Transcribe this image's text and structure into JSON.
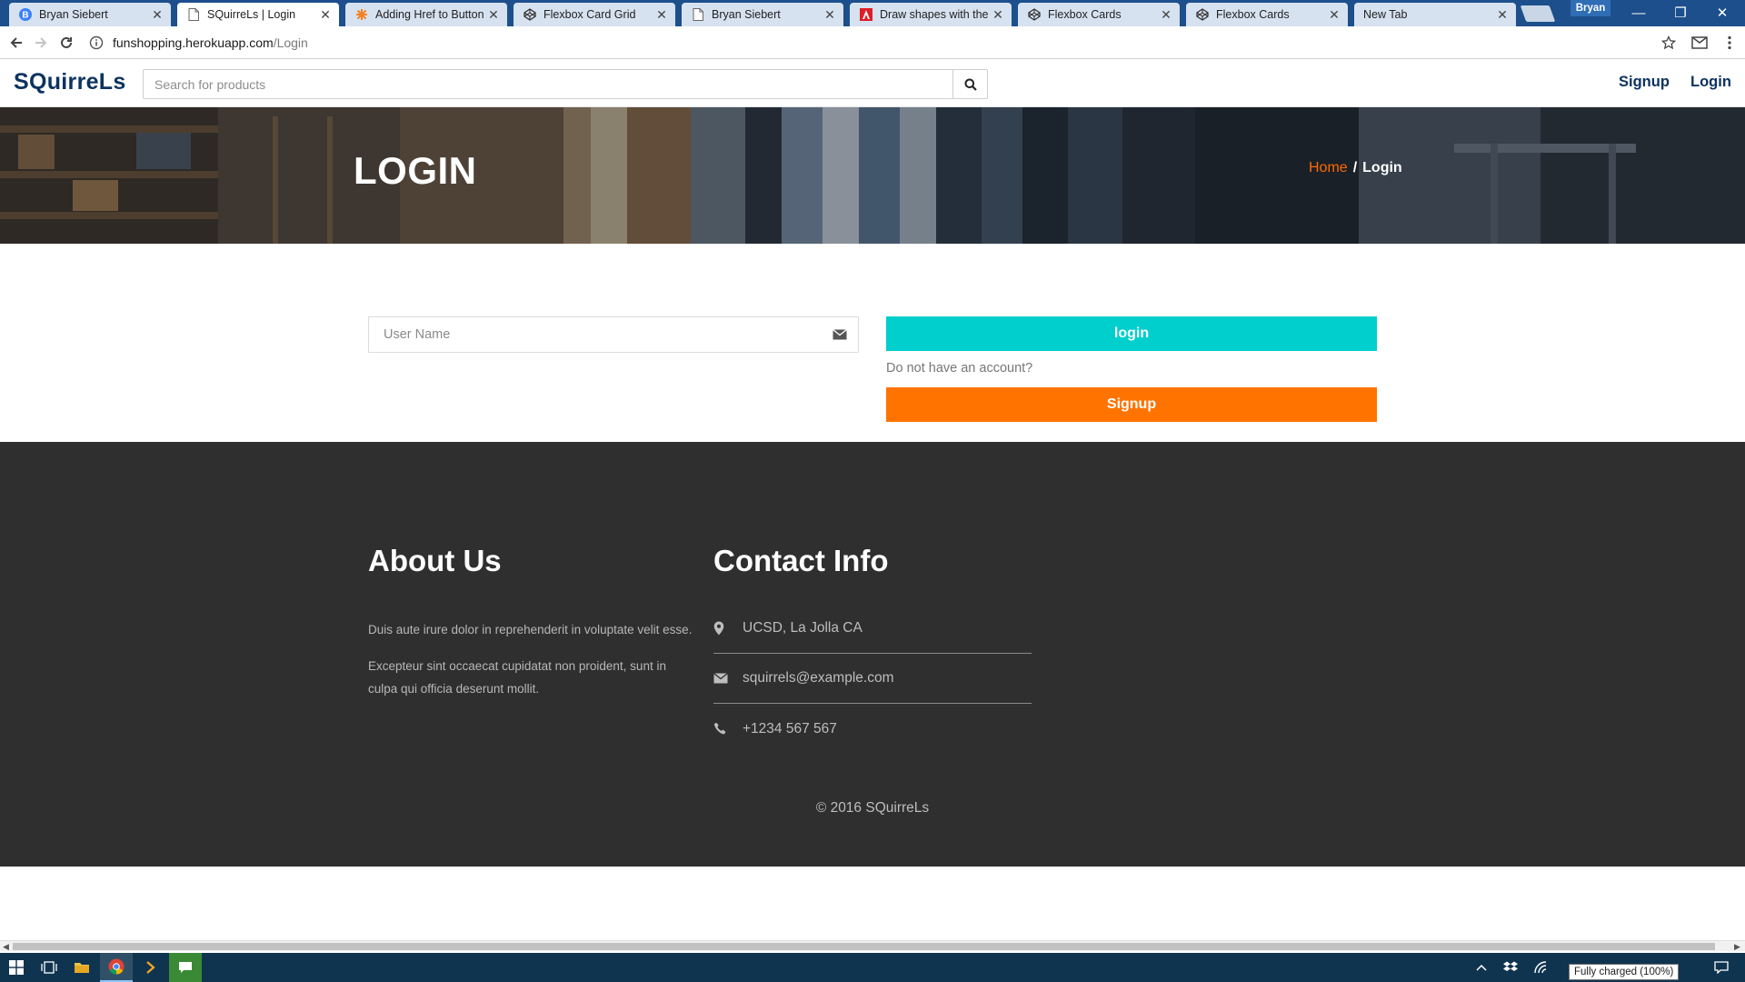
{
  "browser": {
    "tabs": [
      {
        "title": "Bryan Siebert",
        "icon": "b-circle-icon",
        "active": false
      },
      {
        "title": "SQuirreLs | Login",
        "icon": "page-icon",
        "active": true
      },
      {
        "title": "Adding Href to Button",
        "icon": "stackoverflow-icon",
        "active": false
      },
      {
        "title": "Flexbox Card Grid",
        "icon": "codepen-icon",
        "active": false
      },
      {
        "title": "Bryan Siebert",
        "icon": "page-icon",
        "active": false
      },
      {
        "title": "Draw shapes with the s",
        "icon": "adobe-icon",
        "active": false
      },
      {
        "title": "Flexbox Cards",
        "icon": "codepen-icon",
        "active": false
      },
      {
        "title": "Flexbox Cards",
        "icon": "codepen-icon",
        "active": false
      },
      {
        "title": "New Tab",
        "icon": "none",
        "active": false
      }
    ],
    "profile_name": "Bryan",
    "url_host": "funshopping.herokuapp.com",
    "url_path": "/Login"
  },
  "site": {
    "logo": "SQuirreLs",
    "search_placeholder": "Search for products",
    "nav": {
      "signup": "Signup",
      "login": "Login"
    }
  },
  "hero": {
    "title": "LOGIN",
    "breadcrumb": {
      "home": "Home",
      "separator": "/",
      "current": "Login"
    }
  },
  "login_form": {
    "username_placeholder": "User Name",
    "login_button": "login",
    "no_account_text": "Do not have an account?",
    "signup_button": "Signup"
  },
  "footer": {
    "about": {
      "heading": "About Us",
      "paragraphs": [
        "Duis aute irure dolor in reprehenderit in voluptate velit esse.",
        "Excepteur sint occaecat cupidatat non proident, sunt in culpa qui officia deserunt mollit."
      ]
    },
    "contact": {
      "heading": "Contact Info",
      "address": "UCSD, La Jolla CA",
      "email": "squirrels@example.com",
      "phone": "+1234 567 567"
    },
    "copyright": "© 2016 SQuirreLs"
  },
  "system": {
    "tooltip": "Fully charged (100%)"
  },
  "colors": {
    "tabbar": "#1c4f8c",
    "brand": "#0d3360",
    "login_button": "#00cfce",
    "signup_button": "#ff7400",
    "breadcrumb_home": "#ff6a00",
    "footer_bg": "#2f2f2f",
    "taskbar": "#0f3450"
  }
}
